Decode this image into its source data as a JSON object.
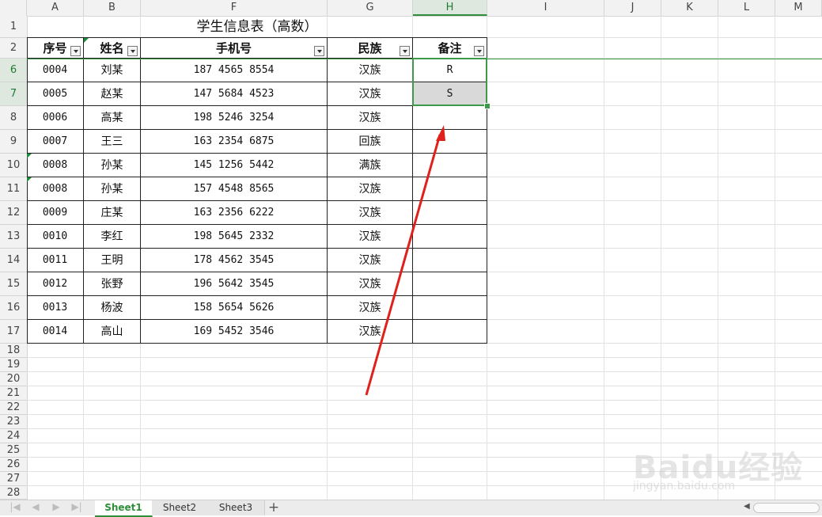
{
  "columns": [
    "A",
    "B",
    "F",
    "G",
    "H",
    "I",
    "J",
    "K",
    "L",
    "M"
  ],
  "selected_column": "H",
  "row_numbers": [
    "1",
    "2",
    "6",
    "7",
    "8",
    "9",
    "10",
    "11",
    "12",
    "13",
    "14",
    "15",
    "16",
    "17",
    "18",
    "19",
    "20",
    "21",
    "22",
    "23",
    "24",
    "25",
    "26",
    "27",
    "28"
  ],
  "selected_rows": [
    "6",
    "7"
  ],
  "table": {
    "title": "学生信息表（高数）",
    "headers": [
      "序号",
      "姓名",
      "手机号",
      "民族",
      "备注"
    ],
    "rows": [
      [
        "0004",
        "刘某",
        "187 4565 8554",
        "汉族",
        "R"
      ],
      [
        "0005",
        "赵某",
        "147 5684 4523",
        "汉族",
        "S"
      ],
      [
        "0006",
        "高某",
        "198 5246 3254",
        "汉族",
        ""
      ],
      [
        "0007",
        "王三",
        "163 2354 6875",
        "回族",
        ""
      ],
      [
        "0008",
        "孙某",
        "145 1256 5442",
        "满族",
        ""
      ],
      [
        "0008",
        "孙某",
        "157 4548 8565",
        "汉族",
        ""
      ],
      [
        "0009",
        "庄某",
        "163 2356 6222",
        "汉族",
        ""
      ],
      [
        "0010",
        "李红",
        "198 5645 2332",
        "汉族",
        ""
      ],
      [
        "0011",
        "王明",
        "178 4562 3545",
        "汉族",
        ""
      ],
      [
        "0012",
        "张野",
        "196 5642 3545",
        "汉族",
        ""
      ],
      [
        "0013",
        "杨波",
        "158 5654 5626",
        "汉族",
        ""
      ],
      [
        "0014",
        "高山",
        "169 5452 3546",
        "汉族",
        ""
      ]
    ]
  },
  "sheets": [
    "Sheet1",
    "Sheet2",
    "Sheet3"
  ],
  "active_sheet": "Sheet1",
  "add_sheet_label": "+",
  "watermark": {
    "brand": "Baidu经验",
    "url": "jingyan.baidu.com"
  },
  "colors": {
    "accent_green": "#2f8f3a",
    "selection_fill": "#d9d9d9",
    "arrow_red": "#e0201b"
  }
}
